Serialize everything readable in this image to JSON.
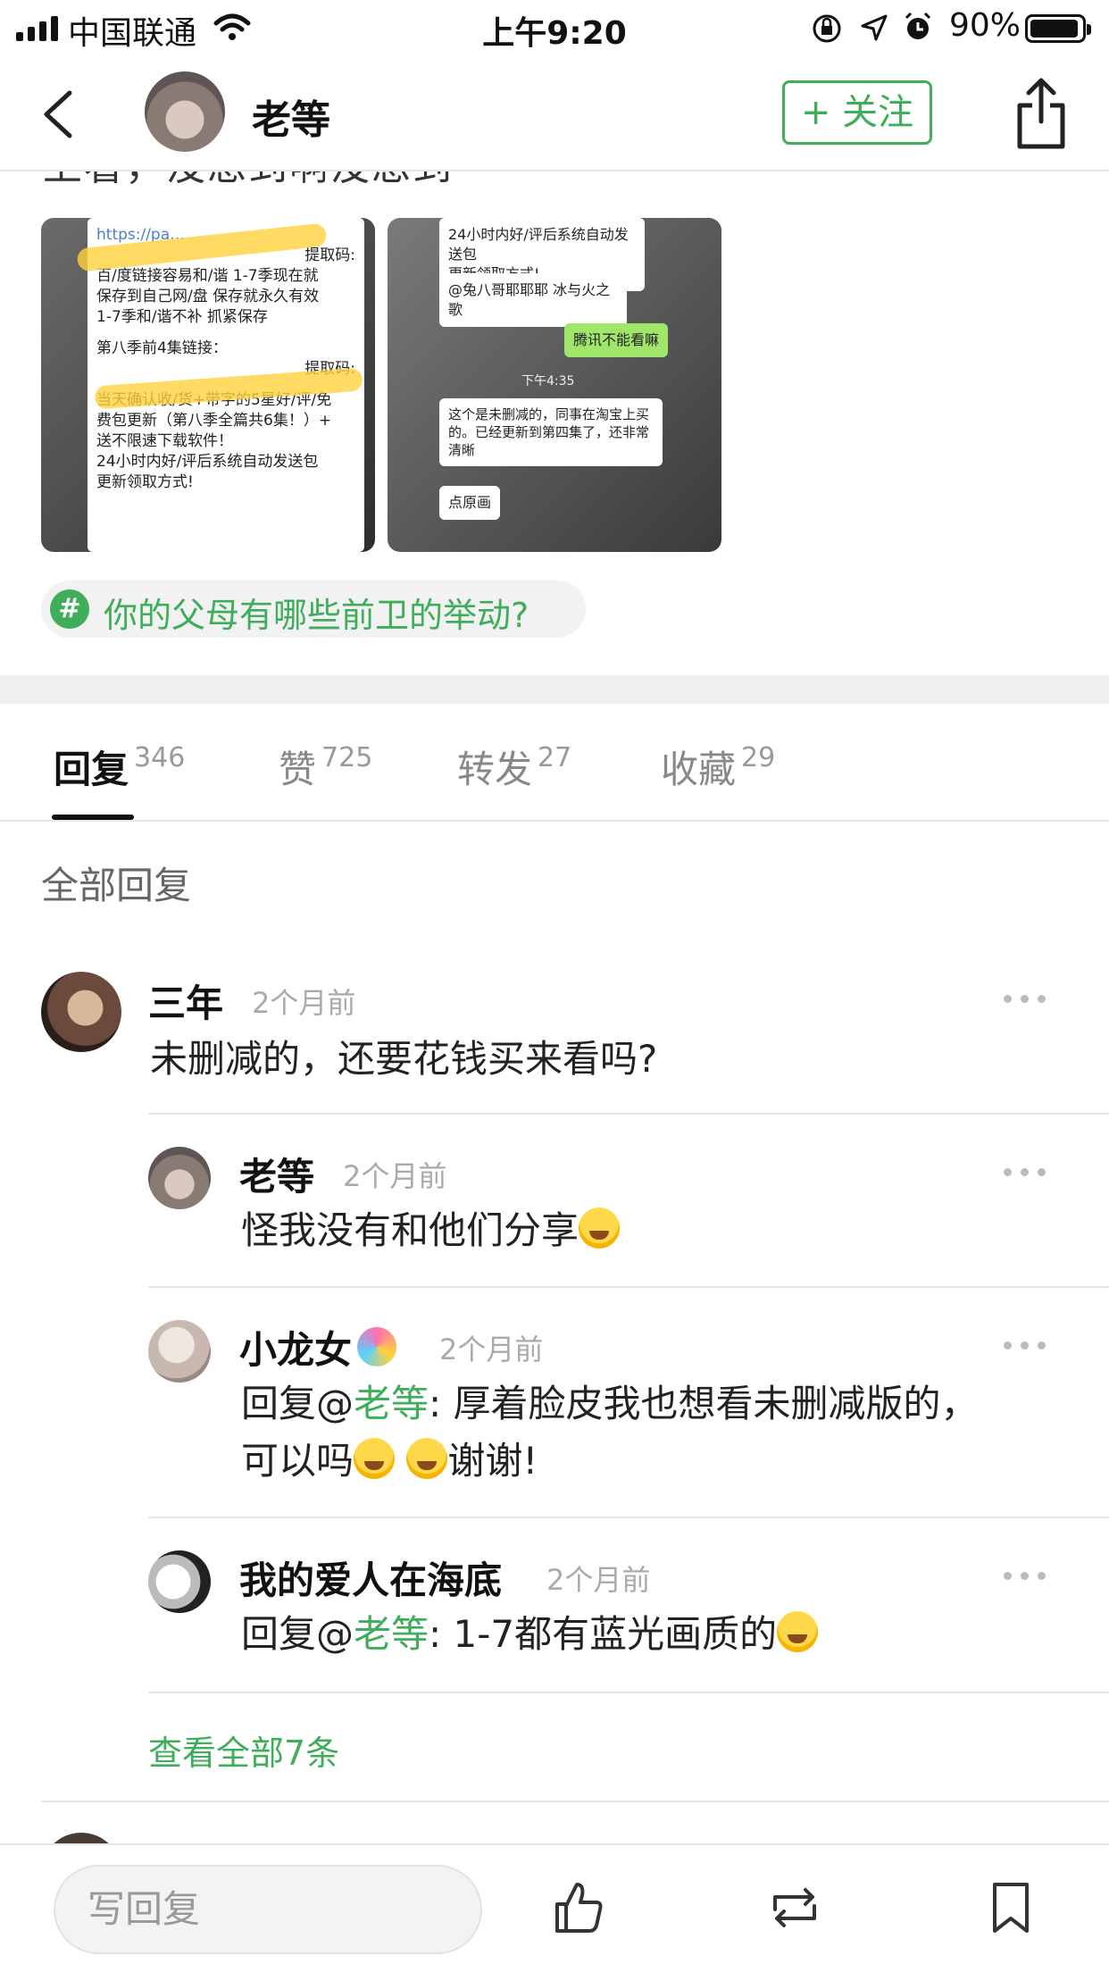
{
  "status": {
    "carrier": "中国联通",
    "time": "上午9:20",
    "battery": "90%"
  },
  "nav": {
    "username": "老等",
    "follow_label": "+ 关注"
  },
  "post": {
    "cut_text": "上看，没想到啊没想到",
    "image1": {
      "lines": [
        "https://pa…",
        "提取码:",
        "百/度链接容易和/谐 1-7季现在就",
        "保存到自己网/盘 保存就永久有效",
        "1-7季和/谐不补 抓紧保存",
        "第八季前4集链接：",
        "提取码:",
        "当天确认收/货+带字的5星好/评/免",
        "费包更新（第八季全篇共6集！）+",
        "送不限速下载软件！",
        "24小时内好/评后系统自动发送包",
        "更新领取方式!"
      ]
    },
    "image2": {
      "lines": [
        "24小时内好/评后系统自动发送包",
        "更新领取方式!",
        "@兔八哥耶耶耶 冰与火之歌",
        "腾讯不能看嘛",
        "下午4:35",
        "这个是未删减的，同事在淘宝上买的。已经更新到第四集了，还非常清晰",
        "点原画"
      ]
    },
    "topic": "你的父母有哪些前卫的举动?"
  },
  "tabs": [
    {
      "label": "回复",
      "count": "346"
    },
    {
      "label": "赞",
      "count": "725"
    },
    {
      "label": "转发",
      "count": "27"
    },
    {
      "label": "收藏",
      "count": "29"
    }
  ],
  "section_title": "全部回复",
  "comments": {
    "main": {
      "name": "三年",
      "time": "2个月前",
      "body": "未删减的，还要花钱买来看吗?"
    },
    "reply1": {
      "name": "老等",
      "time": "2个月前",
      "body": "怪我没有和他们分享"
    },
    "reply2": {
      "name": "小龙女",
      "time": "2个月前",
      "prefix": "回复@",
      "mention": "老等",
      "body": ": 厚着脸皮我也想看未删减版的，",
      "body2": "可以吗",
      "body2_end": "谢谢!"
    },
    "reply3": {
      "name": "我的爱人在海底",
      "time": "2个月前",
      "prefix": "回复@",
      "mention": "老等",
      "body": ": 1-7都有蓝光画质的"
    }
  },
  "view_all": "查看全部7条",
  "bottom": {
    "reply_placeholder": "写回复"
  },
  "colors": {
    "accent": "#3fae5a"
  }
}
